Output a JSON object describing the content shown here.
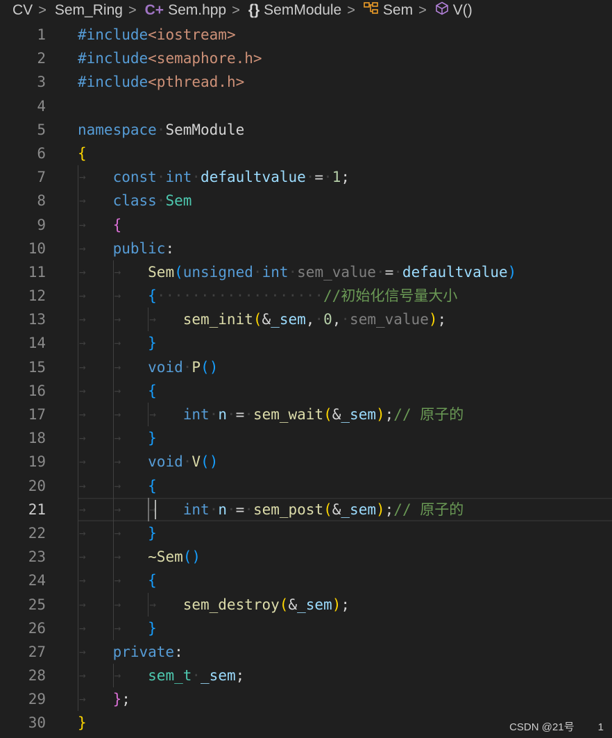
{
  "breadcrumb": {
    "items": [
      {
        "label": "CV",
        "icon": ""
      },
      {
        "label": "Sem_Ring",
        "icon": ""
      },
      {
        "label": "Sem.hpp",
        "icon": "cpp-file-icon"
      },
      {
        "label": "SemModule",
        "icon": "namespace-icon"
      },
      {
        "label": "Sem",
        "icon": "class-icon"
      },
      {
        "label": "V()",
        "icon": "method-icon"
      }
    ],
    "separator": ">"
  },
  "editor": {
    "current_line": 21,
    "lines": [
      {
        "n": "1",
        "text": "#include<iostream>"
      },
      {
        "n": "2",
        "text": "#include<semaphore.h>"
      },
      {
        "n": "3",
        "text": "#include<pthread.h>"
      },
      {
        "n": "4",
        "text": ""
      },
      {
        "n": "5",
        "text": "namespace SemModule"
      },
      {
        "n": "6",
        "text": "{"
      },
      {
        "n": "7",
        "text": "    const int defaultvalue = 1;"
      },
      {
        "n": "8",
        "text": "    class Sem"
      },
      {
        "n": "9",
        "text": "    {"
      },
      {
        "n": "10",
        "text": "    public:"
      },
      {
        "n": "11",
        "text": "        Sem(unsigned int sem_value = defaultvalue)"
      },
      {
        "n": "12",
        "text": "        {                   //初始化信号量大小"
      },
      {
        "n": "13",
        "text": "            sem_init(&_sem, 0, sem_value);"
      },
      {
        "n": "14",
        "text": "        }"
      },
      {
        "n": "15",
        "text": "        void P()"
      },
      {
        "n": "16",
        "text": "        {"
      },
      {
        "n": "17",
        "text": "            int n = sem_wait(&_sem);// 原子的"
      },
      {
        "n": "18",
        "text": "        }"
      },
      {
        "n": "19",
        "text": "        void V()"
      },
      {
        "n": "20",
        "text": "        {"
      },
      {
        "n": "21",
        "text": "            int n = sem_post(&_sem);// 原子的"
      },
      {
        "n": "22",
        "text": "        }"
      },
      {
        "n": "23",
        "text": "        ~Sem()"
      },
      {
        "n": "24",
        "text": "        {"
      },
      {
        "n": "25",
        "text": "            sem_destroy(&_sem);"
      },
      {
        "n": "26",
        "text": "        }"
      },
      {
        "n": "27",
        "text": "    private:"
      },
      {
        "n": "28",
        "text": "        sem_t _sem;"
      },
      {
        "n": "29",
        "text": "    };"
      },
      {
        "n": "30",
        "text": "}"
      }
    ]
  },
  "watermark": "CSDN @21号",
  "status_fragment": "1",
  "colors": {
    "background": "#1f1f1f",
    "keyword": "#569cd6",
    "type": "#4ec9b0",
    "function": "#dcdcaa",
    "string": "#ce9178",
    "number": "#b5cea8",
    "comment": "#6a9955",
    "bracket_gold": "#ffd700",
    "bracket_pink": "#da70d6",
    "bracket_blue": "#179fff"
  }
}
